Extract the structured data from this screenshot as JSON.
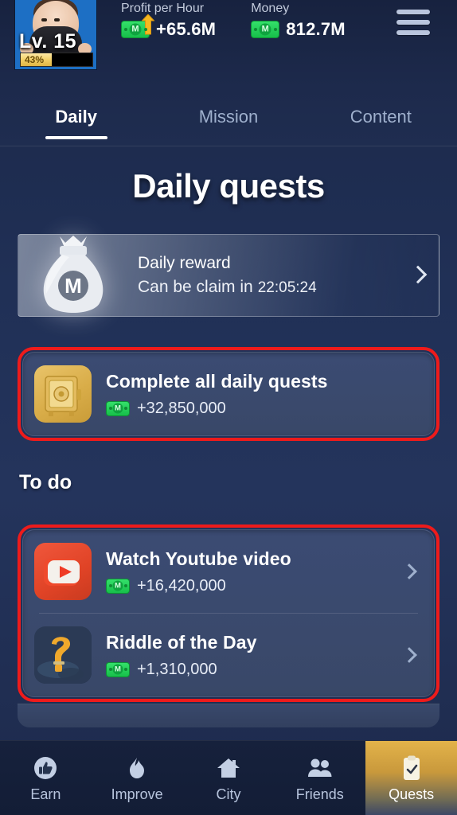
{
  "header": {
    "avatar": {
      "level_label": "Lv. 15",
      "progress_label": "43%",
      "progress_pct": 43
    },
    "stats": [
      {
        "label": "Profit per Hour",
        "value": "+65.6M",
        "icon": "money-note-up-icon"
      },
      {
        "label": "Money",
        "value": "812.7M",
        "icon": "money-note-icon"
      }
    ],
    "menu_icon": "hamburger-menu-icon"
  },
  "tabs": [
    {
      "label": "Daily",
      "active": true
    },
    {
      "label": "Mission",
      "active": false
    },
    {
      "label": "Content",
      "active": false
    }
  ],
  "main": {
    "title": "Daily quests",
    "daily_reward": {
      "icon": "money-bag-icon",
      "title": "Daily reward",
      "status_prefix": "Can be claim in",
      "timer": "22:05:24",
      "chevron": "chevron-right-icon"
    },
    "complete_all": {
      "icon": "safe-vault-icon",
      "title": "Complete all daily quests",
      "reward": "+32,850,000",
      "highlighted": true
    },
    "todo_section_label": "To do",
    "todo": [
      {
        "icon": "youtube-icon",
        "title": "Watch Youtube video",
        "reward": "+16,420,000",
        "chevron": "chevron-right-icon"
      },
      {
        "icon": "question-mark-icon",
        "title": "Riddle of the Day",
        "reward": "+1,310,000",
        "chevron": "chevron-right-icon"
      }
    ]
  },
  "bottom_nav": [
    {
      "label": "Earn",
      "icon": "thumbs-up-icon",
      "active": false
    },
    {
      "label": "Improve",
      "icon": "flame-icon",
      "active": false
    },
    {
      "label": "City",
      "icon": "home-icon",
      "active": false
    },
    {
      "label": "Friends",
      "icon": "people-icon",
      "active": false
    },
    {
      "label": "Quests",
      "icon": "clipboard-check-icon",
      "active": true
    }
  ],
  "colors": {
    "background": "#1d2a4c",
    "card": "#3b4b73",
    "highlight_border": "#ee1b1b",
    "money_green": "#17bf4a",
    "accent_gold": "#e3b34a",
    "text_primary": "#ffffff",
    "text_muted": "#9fb0cd"
  }
}
